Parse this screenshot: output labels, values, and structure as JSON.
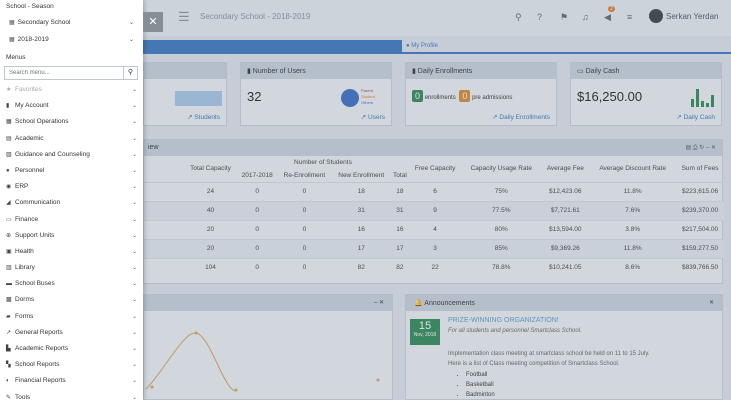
{
  "topbar": {
    "title": "Secondary School - 2018-2019",
    "notif_count": "2",
    "user_name": "Serkan Yerdan",
    "icons": [
      "search-icon",
      "help-icon",
      "flag-icon",
      "bell-icon",
      "announcement-icon",
      "list-icon"
    ]
  },
  "tabs": {
    "profile": "My Profile"
  },
  "cards": {
    "students_link": "Students",
    "users_title": "Number of Users",
    "users_value": "32",
    "users_legend": [
      "Parent",
      "Student",
      "Others"
    ],
    "users_link": "Users",
    "enroll_title": "Daily Enrollments",
    "enroll_count1": "0",
    "enroll_label1": "enrollments",
    "enroll_count2": "0",
    "enroll_label2": "pre admissions",
    "enroll_link": "Daily Enrollments",
    "cash_title": "Daily Cash",
    "cash_value": "$16,250.00",
    "cash_link": "Daily Cash"
  },
  "overview": {
    "title_fragment": "iew",
    "headers": {
      "total_capacity": "Total Capacity",
      "number_of_students": "Number of Students",
      "y1718": "2017-2018",
      "re_enrollment": "Re-Enrollment",
      "new_enrollment": "New Enrollment",
      "total": "Total",
      "free_capacity": "Free Capacity",
      "usage_rate": "Capacity Usage Rate",
      "avg_fee": "Average Fee",
      "avg_discount": "Average Discount Rate",
      "sum_fees": "Sum of Fees"
    },
    "rows": [
      [
        "24",
        "0",
        "0",
        "18",
        "18",
        "6",
        "75%",
        "$12,423.06",
        "11.8%",
        "$223,615.06"
      ],
      [
        "40",
        "0",
        "0",
        "31",
        "31",
        "9",
        "77.5%",
        "$7,721.61",
        "7.6%",
        "$239,370.00"
      ],
      [
        "20",
        "0",
        "0",
        "16",
        "16",
        "4",
        "80%",
        "$13,594.00",
        "3.8%",
        "$217,504.00"
      ],
      [
        "20",
        "0",
        "0",
        "17",
        "17",
        "3",
        "85%",
        "$9,369.26",
        "11.8%",
        "$159,277.50"
      ],
      [
        "104",
        "0",
        "0",
        "82",
        "82",
        "22",
        "78.8%",
        "$10,241.05",
        "8.6%",
        "$839,766.50"
      ]
    ]
  },
  "announcements": {
    "title": "Announcements",
    "day": "15",
    "month": "Nov, 2018",
    "item_title": "PRIZE-WINNING ORGANIZATION!",
    "item_sub": "For all students and personnel Smartclass School.",
    "body_line1": "Implementation class meeting at smartclass school be held on 11 to 15 July.",
    "body_line2": "Here is a list of Class meeting competition of Smartclass School.",
    "list": [
      "Football",
      "Basketball",
      "Badminton"
    ]
  },
  "sidebar": {
    "season_label": "School - Season",
    "school": "Secondary School",
    "season": "2018-2019",
    "menus_label": "Menus",
    "search_placeholder": "Search menu...",
    "items": [
      {
        "label": "Favorites",
        "icon": "star-icon",
        "glyph": "★"
      },
      {
        "label": "My Account",
        "icon": "user-icon",
        "glyph": "▮"
      },
      {
        "label": "School Operations",
        "icon": "school-icon",
        "glyph": "▦"
      },
      {
        "label": "Academic",
        "icon": "academic-icon",
        "glyph": "▤"
      },
      {
        "label": "Guidance and Counseling",
        "icon": "guidance-icon",
        "glyph": "▧"
      },
      {
        "label": "Personnel",
        "icon": "personnel-icon",
        "glyph": "●"
      },
      {
        "label": "ERP",
        "icon": "erp-icon",
        "glyph": "◉"
      },
      {
        "label": "Communication",
        "icon": "communication-icon",
        "glyph": "◢"
      },
      {
        "label": "Finance",
        "icon": "finance-icon",
        "glyph": "▭"
      },
      {
        "label": "Support Units",
        "icon": "support-icon",
        "glyph": "⊕"
      },
      {
        "label": "Health",
        "icon": "health-icon",
        "glyph": "▣"
      },
      {
        "label": "Library",
        "icon": "library-icon",
        "glyph": "▥"
      },
      {
        "label": "School Buses",
        "icon": "bus-icon",
        "glyph": "▬"
      },
      {
        "label": "Dorms",
        "icon": "dorm-icon",
        "glyph": "▩"
      },
      {
        "label": "Forms",
        "icon": "forms-icon",
        "glyph": "▰"
      },
      {
        "label": "General Reports",
        "icon": "general-reports-icon",
        "glyph": "↗"
      },
      {
        "label": "Academic Reports",
        "icon": "academic-reports-icon",
        "glyph": "▙"
      },
      {
        "label": "School Reports",
        "icon": "school-reports-icon",
        "glyph": "▚"
      },
      {
        "label": "Financial Reports",
        "icon": "financial-reports-icon",
        "glyph": "◐"
      },
      {
        "label": "Tools",
        "icon": "tools-icon",
        "glyph": "✎"
      }
    ]
  }
}
